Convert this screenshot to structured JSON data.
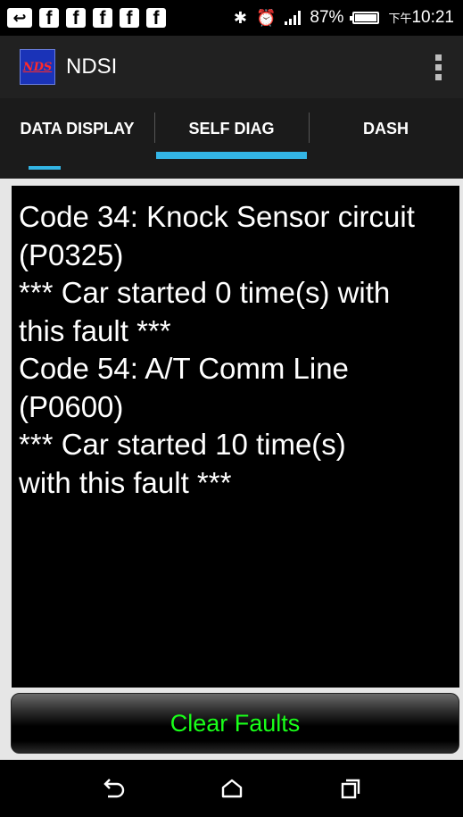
{
  "status_bar": {
    "notification_icons": [
      "back-notification-icon",
      "facebook-icon",
      "facebook-icon",
      "facebook-icon",
      "facebook-icon",
      "facebook-icon"
    ],
    "battery": "87%",
    "time_prefix": "下午",
    "time": "10:21"
  },
  "action_bar": {
    "logo_text": "NDS",
    "title": "NDSI"
  },
  "tabs": [
    {
      "label": "DATA DISPLAY",
      "active": false
    },
    {
      "label": "SELF DIAG",
      "active": true
    },
    {
      "label": "DASH",
      "active": false
    }
  ],
  "faults": [
    "Code 34: Knock Sensor circuit",
    "(P0325)",
    "*** Car started 0 time(s) with",
    "this fault ***",
    "Code 54: A/T Comm Line",
    "(P0600)",
    "*** Car started 10 time(s)",
    "with this fault ***"
  ],
  "clear_button": {
    "label": "Clear Faults"
  },
  "colors": {
    "accent": "#33b5e5",
    "button_text": "#19ff19",
    "action_bar": "#212121"
  }
}
